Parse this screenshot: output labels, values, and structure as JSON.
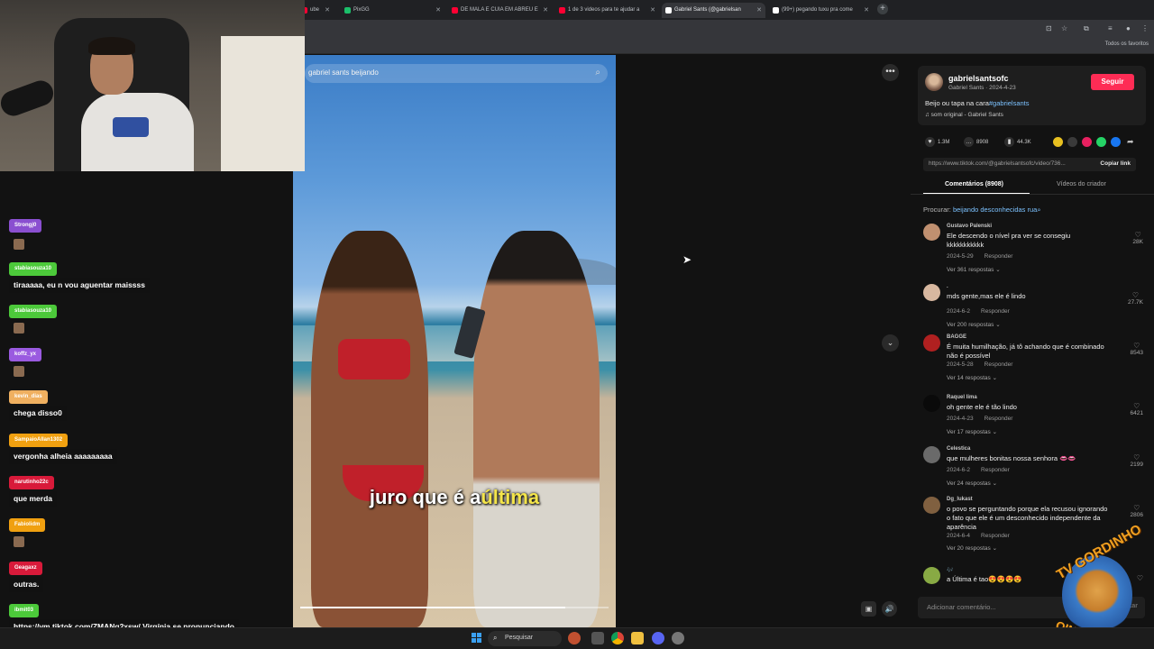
{
  "browser": {
    "tabs": [
      {
        "title": "ube",
        "favicon_color": "#ff0033"
      },
      {
        "title": "PixGG",
        "favicon_color": "#1bbf6a"
      },
      {
        "title": "DE MALA E CUIA EM ABREU E",
        "favicon_color": "#ff0033"
      },
      {
        "title": "1 de 3 videos para te ajudar a",
        "favicon_color": "#ff0033"
      },
      {
        "title": "Gabriel Sants (@gabrielsan",
        "favicon_color": "#ffffff"
      },
      {
        "title": "(99+) pegando tuxu pra come",
        "favicon_color": "#ffffff"
      }
    ],
    "bookmarks_label": "Todos os favoritos"
  },
  "search": {
    "query": "gabriel sants beijando",
    "icon": "search-icon"
  },
  "video": {
    "caption_prefix": "juro que é a",
    "caption_highlight": "última",
    "progress": 0.86
  },
  "creator": {
    "username": "gabrielsantsofc",
    "subtitle": "Gabriel Sants · 2024-4-23",
    "follow_label": "Seguir",
    "description": "Beijo ou tapa na cara",
    "hashtag": "#gabrielsants",
    "sound": "♫ som original - Gabriel Sants"
  },
  "stats": {
    "likes": "1.3M",
    "comments": "8908",
    "saves": "44.3K"
  },
  "share_colors": [
    "#e8c020",
    "#3a3a3a",
    "#e82060",
    "#25d366",
    "#1877f2"
  ],
  "link": {
    "url": "https://www.tiktok.com/@gabrielsantsofc/video/736...",
    "copy_label": "Copiar link"
  },
  "tabs": {
    "comments": "Comentários (8908)",
    "videos": "Vídeos do criador"
  },
  "procurar": {
    "label": "Procurar:",
    "term": "beijando desconhecidas rua"
  },
  "comments": [
    {
      "name": "Gustavo Palenski",
      "text": "Ele descendo o nível pra ver se consegiu kkkkkkkkkkk",
      "date": "2024-5-29",
      "reply": "Responder",
      "replies": "Ver 361 respostas",
      "likes": "28K",
      "avatar": "#c09070"
    },
    {
      "name": ".",
      "text": "mds gente,mas ele é lindo",
      "date": "2024-6-2",
      "reply": "Responder",
      "replies": "Ver 200 respostas",
      "likes": "27.7K",
      "avatar": "#d8b8a0"
    },
    {
      "name": "BAGGE",
      "text": "É muita humilhação, já tô achando que é combinado não é possível",
      "date": "2024-5-28",
      "reply": "Responder",
      "replies": "Ver 14 respostas",
      "likes": "8543",
      "avatar": "#b02020"
    },
    {
      "name": "Raquel lima",
      "text": "oh gente ele é tão lindo",
      "date": "2024-4-23",
      "reply": "Responder",
      "replies": "Ver 17 respostas",
      "likes": "6421",
      "avatar": "#0a0a0a"
    },
    {
      "name": "Celestica",
      "text": "que mulheres bonitas nossa senhora 👄👄",
      "date": "2024-6-2",
      "reply": "Responder",
      "replies": "Ver 24 respostas",
      "likes": "2199",
      "avatar": "#6a6a6a"
    },
    {
      "name": "Dg_lukast",
      "text": "o povo se perguntando porque ela recusou ignorando o fato que ele é um desconhecido independente da aparência",
      "date": "2024-6-4",
      "reply": "Responder",
      "replies": "Ver 20 respostas",
      "likes": "2806",
      "avatar": "#806040"
    },
    {
      "name": "🎶",
      "text": "a Última é tao😍😍😍😍",
      "date": "",
      "reply": "",
      "replies": "",
      "likes": "",
      "avatar": "#88aa44"
    }
  ],
  "comment_input": {
    "placeholder": "Adicionar comentário...",
    "post_label": "Postar"
  },
  "chat": [
    {
      "name": "Strongj0",
      "color": "#8a4fd0",
      "message": ""
    },
    {
      "name": "stabiasouza10",
      "color": "#4cc93a",
      "message": "tiraaaaa, eu n vou aguentar maissss"
    },
    {
      "name": "stabiasouza10",
      "color": "#4cc93a",
      "message": ""
    },
    {
      "name": "koffz_yx",
      "color": "#9a5ae0",
      "message": ""
    },
    {
      "name": "kevin_dias",
      "color": "#f0b060",
      "message": "chega disso0"
    },
    {
      "name": "SampaioAllan1302",
      "color": "#f0a010",
      "message": "vergonha alheia aaaaaaaaa"
    },
    {
      "name": "narutinho22c",
      "color": "#d81a3a",
      "message": "que merda"
    },
    {
      "name": "Fabiolidm",
      "color": "#f0a010",
      "message": ""
    },
    {
      "name": "Geagaxz",
      "color": "#d81a3a",
      "message": "outras."
    },
    {
      "name": "ibmit03",
      "color": "#4cc93a",
      "message": "https://vm.tiktok.com/ZMANq2xsw/ Virgínia se pronunciando"
    }
  ],
  "watermark": {
    "line1": "TV GORDINHO",
    "line2": "OINHOS"
  },
  "taskbar": {
    "search_label": "Pesquisar"
  }
}
